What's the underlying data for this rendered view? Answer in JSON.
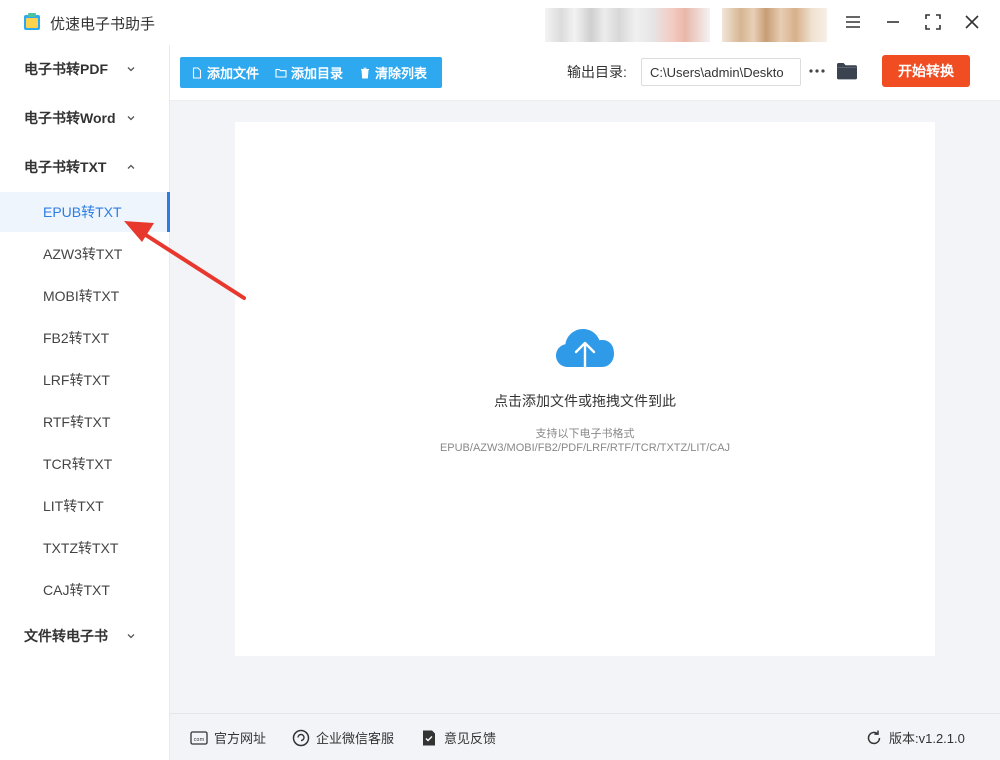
{
  "app": {
    "title": "优速电子书助手"
  },
  "sidebar": {
    "groups": [
      {
        "label": "电子书转PDF",
        "expanded": false
      },
      {
        "label": "电子书转Word",
        "expanded": false
      },
      {
        "label": "电子书转TXT",
        "expanded": true
      },
      {
        "label": "文件转电子书",
        "expanded": false
      }
    ],
    "sub_items": [
      {
        "label": "EPUB转TXT",
        "active": true
      },
      {
        "label": "AZW3转TXT",
        "active": false
      },
      {
        "label": "MOBI转TXT",
        "active": false
      },
      {
        "label": "FB2转TXT",
        "active": false
      },
      {
        "label": "LRF转TXT",
        "active": false
      },
      {
        "label": "RTF转TXT",
        "active": false
      },
      {
        "label": "TCR转TXT",
        "active": false
      },
      {
        "label": "LIT转TXT",
        "active": false
      },
      {
        "label": "TXTZ转TXT",
        "active": false
      },
      {
        "label": "CAJ转TXT",
        "active": false
      }
    ]
  },
  "toolbar": {
    "add_file": "添加文件",
    "add_dir": "添加目录",
    "clear_list": "清除列表",
    "output_label": "输出目录:",
    "output_path": "C:\\Users\\admin\\Deskto",
    "start_label": "开始转换"
  },
  "dropzone": {
    "main_text": "点击添加文件或拖拽文件到此",
    "formats_title": "支持以下电子书格式",
    "formats_list": "EPUB/AZW3/MOBI/FB2/PDF/LRF/RTF/TCR/TXTZ/LIT/CAJ"
  },
  "footer": {
    "website": "官方网址",
    "wechat": "企业微信客服",
    "feedback": "意见反馈",
    "version": "版本:v1.2.1.0"
  },
  "colors": {
    "accent": "#2ea8ef",
    "active_text": "#2e7de4",
    "start_button": "#f04d23",
    "annotation_arrow": "#e8372c"
  }
}
